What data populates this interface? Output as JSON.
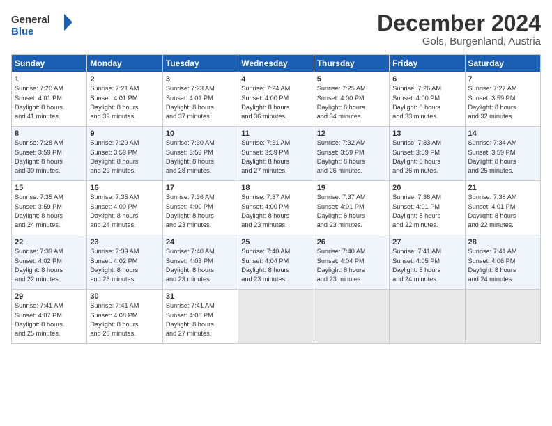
{
  "header": {
    "logo_line1": "General",
    "logo_line2": "Blue",
    "month": "December 2024",
    "location": "Gols, Burgenland, Austria"
  },
  "weekdays": [
    "Sunday",
    "Monday",
    "Tuesday",
    "Wednesday",
    "Thursday",
    "Friday",
    "Saturday"
  ],
  "weeks": [
    [
      {
        "day": "1",
        "lines": [
          "Sunrise: 7:20 AM",
          "Sunset: 4:01 PM",
          "Daylight: 8 hours",
          "and 41 minutes."
        ]
      },
      {
        "day": "2",
        "lines": [
          "Sunrise: 7:21 AM",
          "Sunset: 4:01 PM",
          "Daylight: 8 hours",
          "and 39 minutes."
        ]
      },
      {
        "day": "3",
        "lines": [
          "Sunrise: 7:23 AM",
          "Sunset: 4:01 PM",
          "Daylight: 8 hours",
          "and 37 minutes."
        ]
      },
      {
        "day": "4",
        "lines": [
          "Sunrise: 7:24 AM",
          "Sunset: 4:00 PM",
          "Daylight: 8 hours",
          "and 36 minutes."
        ]
      },
      {
        "day": "5",
        "lines": [
          "Sunrise: 7:25 AM",
          "Sunset: 4:00 PM",
          "Daylight: 8 hours",
          "and 34 minutes."
        ]
      },
      {
        "day": "6",
        "lines": [
          "Sunrise: 7:26 AM",
          "Sunset: 4:00 PM",
          "Daylight: 8 hours",
          "and 33 minutes."
        ]
      },
      {
        "day": "7",
        "lines": [
          "Sunrise: 7:27 AM",
          "Sunset: 3:59 PM",
          "Daylight: 8 hours",
          "and 32 minutes."
        ]
      }
    ],
    [
      {
        "day": "8",
        "lines": [
          "Sunrise: 7:28 AM",
          "Sunset: 3:59 PM",
          "Daylight: 8 hours",
          "and 30 minutes."
        ]
      },
      {
        "day": "9",
        "lines": [
          "Sunrise: 7:29 AM",
          "Sunset: 3:59 PM",
          "Daylight: 8 hours",
          "and 29 minutes."
        ]
      },
      {
        "day": "10",
        "lines": [
          "Sunrise: 7:30 AM",
          "Sunset: 3:59 PM",
          "Daylight: 8 hours",
          "and 28 minutes."
        ]
      },
      {
        "day": "11",
        "lines": [
          "Sunrise: 7:31 AM",
          "Sunset: 3:59 PM",
          "Daylight: 8 hours",
          "and 27 minutes."
        ]
      },
      {
        "day": "12",
        "lines": [
          "Sunrise: 7:32 AM",
          "Sunset: 3:59 PM",
          "Daylight: 8 hours",
          "and 26 minutes."
        ]
      },
      {
        "day": "13",
        "lines": [
          "Sunrise: 7:33 AM",
          "Sunset: 3:59 PM",
          "Daylight: 8 hours",
          "and 26 minutes."
        ]
      },
      {
        "day": "14",
        "lines": [
          "Sunrise: 7:34 AM",
          "Sunset: 3:59 PM",
          "Daylight: 8 hours",
          "and 25 minutes."
        ]
      }
    ],
    [
      {
        "day": "15",
        "lines": [
          "Sunrise: 7:35 AM",
          "Sunset: 3:59 PM",
          "Daylight: 8 hours",
          "and 24 minutes."
        ]
      },
      {
        "day": "16",
        "lines": [
          "Sunrise: 7:35 AM",
          "Sunset: 4:00 PM",
          "Daylight: 8 hours",
          "and 24 minutes."
        ]
      },
      {
        "day": "17",
        "lines": [
          "Sunrise: 7:36 AM",
          "Sunset: 4:00 PM",
          "Daylight: 8 hours",
          "and 23 minutes."
        ]
      },
      {
        "day": "18",
        "lines": [
          "Sunrise: 7:37 AM",
          "Sunset: 4:00 PM",
          "Daylight: 8 hours",
          "and 23 minutes."
        ]
      },
      {
        "day": "19",
        "lines": [
          "Sunrise: 7:37 AM",
          "Sunset: 4:01 PM",
          "Daylight: 8 hours",
          "and 23 minutes."
        ]
      },
      {
        "day": "20",
        "lines": [
          "Sunrise: 7:38 AM",
          "Sunset: 4:01 PM",
          "Daylight: 8 hours",
          "and 22 minutes."
        ]
      },
      {
        "day": "21",
        "lines": [
          "Sunrise: 7:38 AM",
          "Sunset: 4:01 PM",
          "Daylight: 8 hours",
          "and 22 minutes."
        ]
      }
    ],
    [
      {
        "day": "22",
        "lines": [
          "Sunrise: 7:39 AM",
          "Sunset: 4:02 PM",
          "Daylight: 8 hours",
          "and 22 minutes."
        ]
      },
      {
        "day": "23",
        "lines": [
          "Sunrise: 7:39 AM",
          "Sunset: 4:02 PM",
          "Daylight: 8 hours",
          "and 23 minutes."
        ]
      },
      {
        "day": "24",
        "lines": [
          "Sunrise: 7:40 AM",
          "Sunset: 4:03 PM",
          "Daylight: 8 hours",
          "and 23 minutes."
        ]
      },
      {
        "day": "25",
        "lines": [
          "Sunrise: 7:40 AM",
          "Sunset: 4:04 PM",
          "Daylight: 8 hours",
          "and 23 minutes."
        ]
      },
      {
        "day": "26",
        "lines": [
          "Sunrise: 7:40 AM",
          "Sunset: 4:04 PM",
          "Daylight: 8 hours",
          "and 23 minutes."
        ]
      },
      {
        "day": "27",
        "lines": [
          "Sunrise: 7:41 AM",
          "Sunset: 4:05 PM",
          "Daylight: 8 hours",
          "and 24 minutes."
        ]
      },
      {
        "day": "28",
        "lines": [
          "Sunrise: 7:41 AM",
          "Sunset: 4:06 PM",
          "Daylight: 8 hours",
          "and 24 minutes."
        ]
      }
    ],
    [
      {
        "day": "29",
        "lines": [
          "Sunrise: 7:41 AM",
          "Sunset: 4:07 PM",
          "Daylight: 8 hours",
          "and 25 minutes."
        ]
      },
      {
        "day": "30",
        "lines": [
          "Sunrise: 7:41 AM",
          "Sunset: 4:08 PM",
          "Daylight: 8 hours",
          "and 26 minutes."
        ]
      },
      {
        "day": "31",
        "lines": [
          "Sunrise: 7:41 AM",
          "Sunset: 4:08 PM",
          "Daylight: 8 hours",
          "and 27 minutes."
        ]
      },
      null,
      null,
      null,
      null
    ]
  ]
}
